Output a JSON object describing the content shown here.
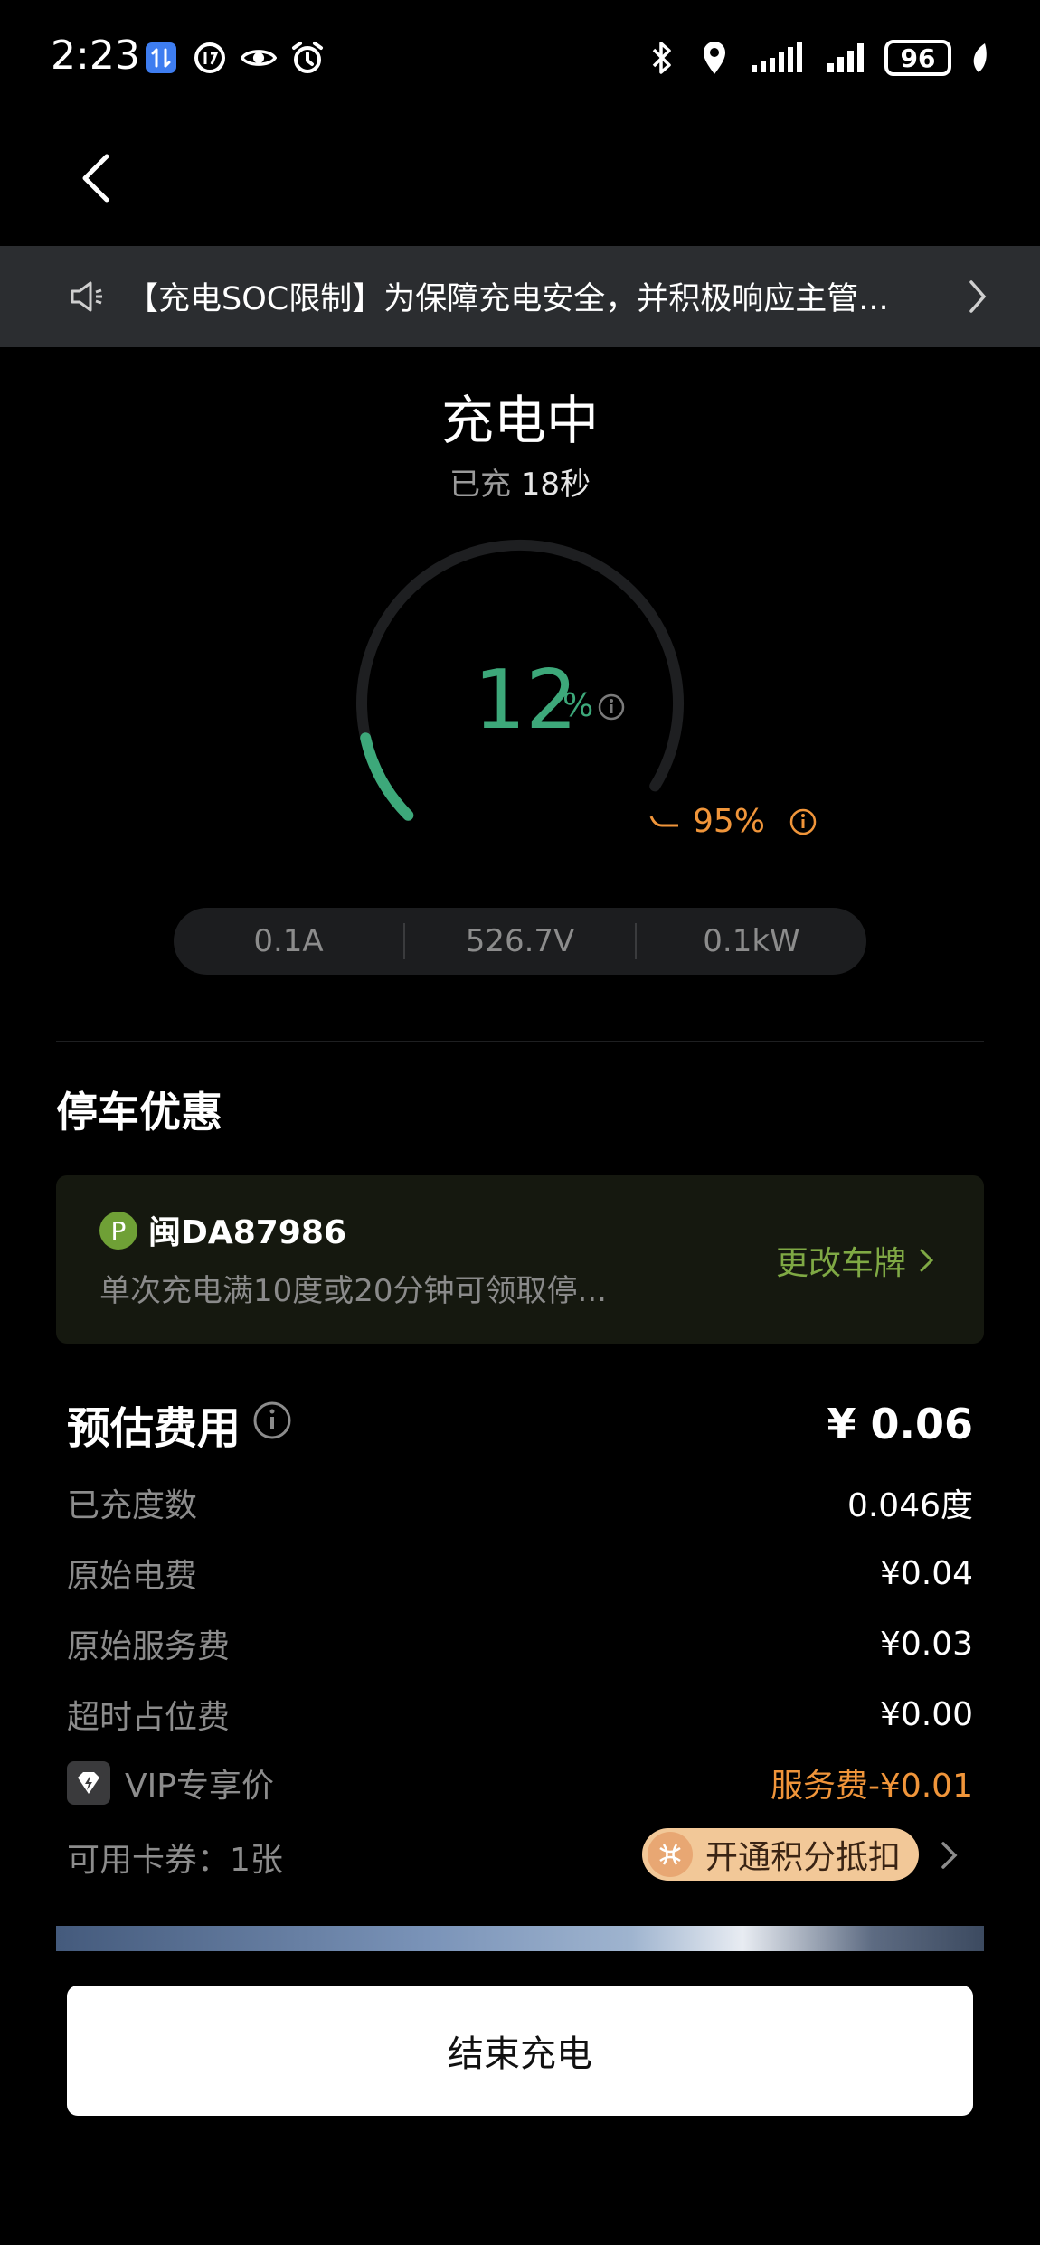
{
  "status_bar": {
    "time": "2:23",
    "battery": "96",
    "left_icons": [
      "data-transfer-icon",
      "timer-app-icon",
      "eye-icon",
      "alarm-icon"
    ],
    "right_icons": [
      "bluetooth-icon",
      "location-icon",
      "signal-icon",
      "signal-icon",
      "battery-icon",
      "leaf-icon"
    ]
  },
  "notice": {
    "text": "【充电SOC限制】为保障充电安全，并积极响应主管..."
  },
  "charging": {
    "title": "充电中",
    "elapsed_label": "已充",
    "elapsed_value": "18秒",
    "soc_value": "12",
    "soc_unit": "%",
    "soc_fraction": 0.12,
    "limit_value": "95%",
    "limit_fraction": 0.95,
    "current": "0.1A",
    "voltage": "526.7V",
    "power": "0.1kW",
    "accent_color": "#3da87a",
    "limit_color": "#f0953a"
  },
  "parking": {
    "title": "停车优惠",
    "badge": "P",
    "plate": "闽DA87986",
    "description": "单次充电满10度或20分钟可领取停...",
    "change_label": "更改车牌"
  },
  "fees": {
    "title": "预估费用",
    "total": "¥ 0.06",
    "rows": [
      {
        "label": "已充度数",
        "value": "0.046度"
      },
      {
        "label": "原始电费",
        "value": "¥0.04"
      },
      {
        "label": "原始服务费",
        "value": "¥0.03"
      },
      {
        "label": "超时占位费",
        "value": "¥0.00"
      }
    ],
    "vip_label": "VIP专享价",
    "vip_value": "服务费-¥0.01",
    "coupon_label": "可用卡券：1张",
    "points_label": "开通积分抵扣"
  },
  "end_button": "结束充电"
}
